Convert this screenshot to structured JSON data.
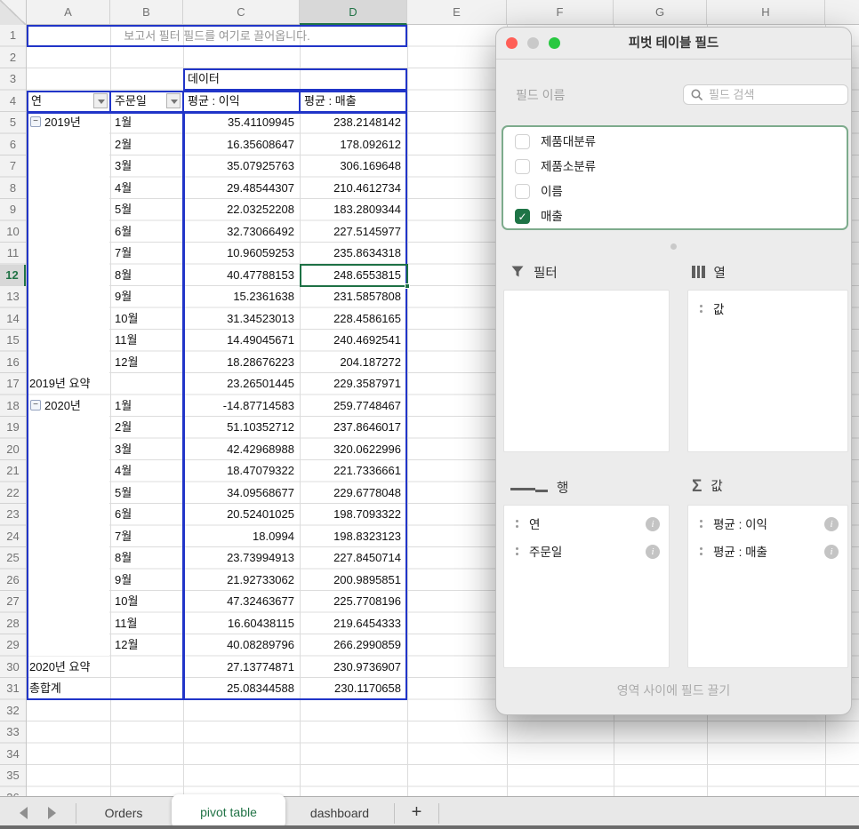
{
  "sheet": {
    "columns": [
      "A",
      "B",
      "C",
      "D",
      "E",
      "F",
      "G",
      "H"
    ],
    "selected_column": "D",
    "selected_row": 12,
    "selected_cell": "D12",
    "row_count": 36,
    "filter_banner": "보고서 필터 필드를 여기로 끌어옵니다."
  },
  "pivot": {
    "data_header": "데이터",
    "row_field_headers": [
      {
        "label": "연",
        "icon": "filter-dropdown"
      },
      {
        "label": "주문일",
        "icon": "filter-dropdown"
      }
    ],
    "value_headers": [
      "평균 : 이익",
      "평균 : 매출"
    ],
    "years": [
      {
        "label": "2019년",
        "months": [
          {
            "month": "1월",
            "profit": "35.41109945",
            "sales": "238.2148142"
          },
          {
            "month": "2월",
            "profit": "16.35608647",
            "sales": "178.092612"
          },
          {
            "month": "3월",
            "profit": "35.07925763",
            "sales": "306.169648"
          },
          {
            "month": "4월",
            "profit": "29.48544307",
            "sales": "210.4612734"
          },
          {
            "month": "5월",
            "profit": "22.03252208",
            "sales": "183.2809344"
          },
          {
            "month": "6월",
            "profit": "32.73066492",
            "sales": "227.5145977"
          },
          {
            "month": "7월",
            "profit": "10.96059253",
            "sales": "235.8634318"
          },
          {
            "month": "8월",
            "profit": "40.47788153",
            "sales": "248.6553815"
          },
          {
            "month": "9월",
            "profit": "15.2361638",
            "sales": "231.5857808"
          },
          {
            "month": "10월",
            "profit": "31.34523013",
            "sales": "228.4586165"
          },
          {
            "month": "11월",
            "profit": "14.49045671",
            "sales": "240.4692541"
          },
          {
            "month": "12월",
            "profit": "18.28676223",
            "sales": "204.187272"
          }
        ],
        "summary": {
          "label": "2019년 요약",
          "profit": "23.26501445",
          "sales": "229.3587971"
        }
      },
      {
        "label": "2020년",
        "months": [
          {
            "month": "1월",
            "profit": "-14.87714583",
            "sales": "259.7748467"
          },
          {
            "month": "2월",
            "profit": "51.10352712",
            "sales": "237.8646017"
          },
          {
            "month": "3월",
            "profit": "42.42968988",
            "sales": "320.0622996"
          },
          {
            "month": "4월",
            "profit": "18.47079322",
            "sales": "221.7336661"
          },
          {
            "month": "5월",
            "profit": "34.09568677",
            "sales": "229.6778048"
          },
          {
            "month": "6월",
            "profit": "20.52401025",
            "sales": "198.7093322"
          },
          {
            "month": "7월",
            "profit": "18.0994",
            "sales": "198.8323123"
          },
          {
            "month": "8월",
            "profit": "23.73994913",
            "sales": "227.8450714"
          },
          {
            "month": "9월",
            "profit": "21.92733062",
            "sales": "200.9895851"
          },
          {
            "month": "10월",
            "profit": "47.32463677",
            "sales": "225.7708196"
          },
          {
            "month": "11월",
            "profit": "16.60438115",
            "sales": "219.6454333"
          },
          {
            "month": "12월",
            "profit": "40.08289796",
            "sales": "266.2990859"
          }
        ],
        "summary": {
          "label": "2020년 요약",
          "profit": "27.13774871",
          "sales": "230.9736907"
        }
      }
    ],
    "grand_total": {
      "label": "총합계",
      "profit": "25.08344588",
      "sales": "230.1170658"
    }
  },
  "panel": {
    "title": "피벗 테이블 필드",
    "field_name_label": "필드 이름",
    "search_placeholder": "필드 검색",
    "fields": [
      {
        "label": "제품대분류",
        "checked": false
      },
      {
        "label": "제품소분류",
        "checked": false
      },
      {
        "label": "이름",
        "checked": false
      },
      {
        "label": "매출",
        "checked": true
      }
    ],
    "areas": {
      "filters": {
        "label": "필터",
        "items": []
      },
      "columns": {
        "label": "열",
        "items": [
          {
            "label": "값",
            "info": false
          }
        ]
      },
      "rows": {
        "label": "행",
        "items": [
          {
            "label": "연",
            "info": true
          },
          {
            "label": "주문일",
            "info": true
          }
        ]
      },
      "values": {
        "label": "값",
        "items": [
          {
            "label": "평균 : 이익",
            "info": true
          },
          {
            "label": "평균 : 매출",
            "info": true
          }
        ]
      }
    },
    "hint": "영역 사이에 필드 끌기"
  },
  "tabs": {
    "items": [
      {
        "label": "Orders",
        "active": false
      },
      {
        "label": "pivot table",
        "active": true
      },
      {
        "label": "dashboard",
        "active": false
      }
    ],
    "add_label": "+"
  },
  "colors": {
    "pivot_border_blue": "#2135c8",
    "excel_green": "#217346",
    "checkbox_green": "#1e7446",
    "field_list_border": "#7dab8c",
    "traffic_red": "#ff5f57",
    "traffic_gray": "#c9c9c9",
    "traffic_green": "#28c840"
  }
}
